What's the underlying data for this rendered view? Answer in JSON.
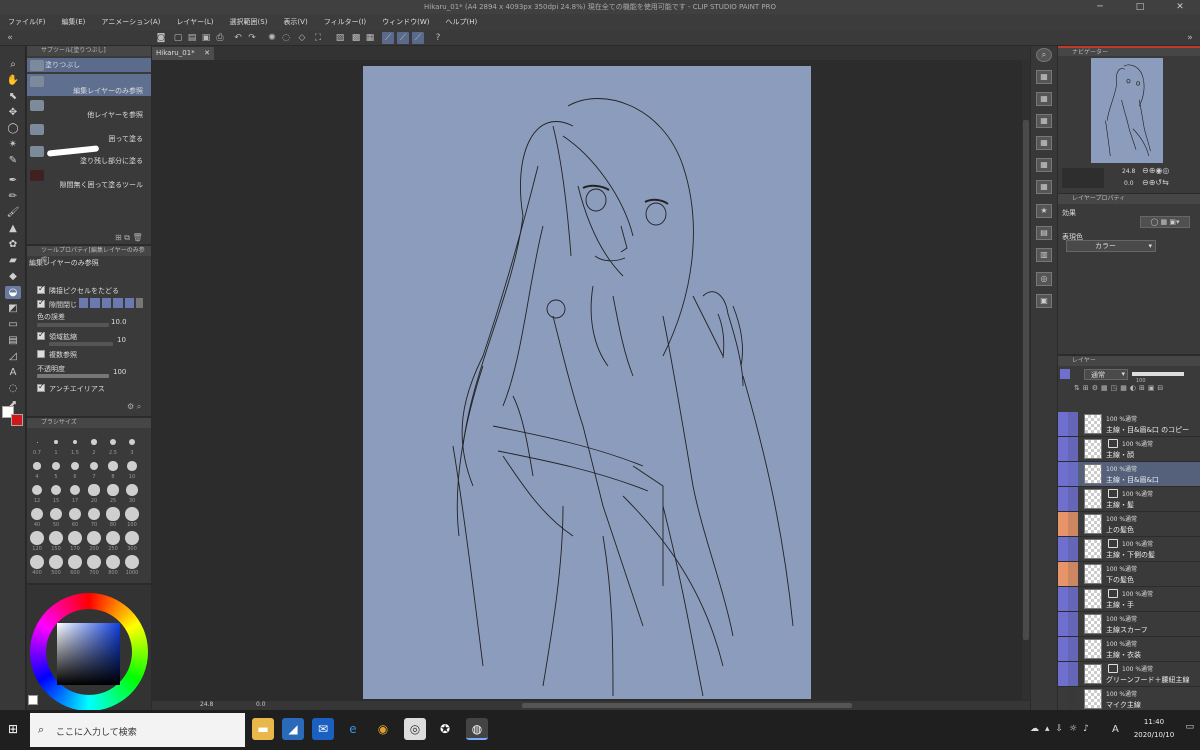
{
  "window": {
    "title": "Hikaru_01* (A4 2894 x 4093px 350dpi 24.8%)  現在全ての機能を使用可能です - CLIP STUDIO PAINT PRO"
  },
  "menu": [
    "ファイル(F)",
    "編集(E)",
    "アニメーション(A)",
    "レイヤー(L)",
    "選択範囲(S)",
    "表示(V)",
    "フィルター(I)",
    "ウィンドウ(W)",
    "ヘルプ(H)"
  ],
  "subtool": {
    "title": "サブツール[塗りつぶし]",
    "items": [
      {
        "label": "塗りつぶし"
      },
      {
        "label": "編集レイヤーのみ参照"
      },
      {
        "label": "他レイヤーを参照"
      },
      {
        "label": "囲って塗る"
      },
      {
        "label": "塗り残し部分に塗る"
      },
      {
        "label": "隙間無く囲って塗るツール"
      }
    ]
  },
  "toolprop": {
    "title": "ツールプロパティ[編集レイヤーのみ参照]",
    "name": "編集レイヤーのみ参照",
    "follow": "隣接ピクセルをたどる",
    "gap": "隙間閉じ",
    "tolerance_label": "色の誤差",
    "tolerance": "10.0",
    "expand_label": "領域拡縮",
    "expand": "10",
    "multi": "複数参照",
    "opacity_label": "不透明度",
    "opacity": "100",
    "aa": "アンチエイリアス"
  },
  "brushsize": {
    "title": "ブラシサイズ",
    "sizes": [
      "0.7",
      "1",
      "1.5",
      "2",
      "2.5",
      "3",
      "4",
      "5",
      "6",
      "7",
      "8",
      "10",
      "12",
      "15",
      "17",
      "20",
      "25",
      "30",
      "40",
      "50",
      "60",
      "70",
      "80",
      "100",
      "120",
      "150",
      "170",
      "200",
      "250",
      "300",
      "400",
      "500",
      "600",
      "700",
      "800",
      "1000"
    ]
  },
  "color": {
    "r": "222",
    "g": "3",
    "b": "95"
  },
  "canvas": {
    "tab": "Hikaru_01*",
    "zoom": "24.8",
    "angle": "0.0"
  },
  "navigator": {
    "title": "ナビゲーター",
    "zoom": "24.8",
    "angle": "0.0"
  },
  "layerprop": {
    "title": "レイヤープロパティ",
    "effect": "効果",
    "expression": "表現色",
    "color_mode": "カラー"
  },
  "layers": {
    "title": "レイヤー",
    "blend": "通常",
    "opacity": "100",
    "items": [
      {
        "top": "100 %通常",
        "name": "主線・目&眉&口 のコピー",
        "color": "#6f6fd0",
        "folder": false
      },
      {
        "top": "100 %通常",
        "name": "主線・顔",
        "color": "#6f6fd0",
        "folder": true
      },
      {
        "top": "100 %通常",
        "name": "主線・目&眉&口",
        "color": "#6f6fd0",
        "folder": false,
        "selected": true
      },
      {
        "top": "100 %通常",
        "name": "主線・髪",
        "color": "#6f6fd0",
        "folder": true
      },
      {
        "top": "100 %通常",
        "name": "上の髪色",
        "color": "#e8946a",
        "folder": false
      },
      {
        "top": "100 %通常",
        "name": "主線・下側の髪",
        "color": "#6f6fd0",
        "folder": true
      },
      {
        "top": "100 %通常",
        "name": "下の髪色",
        "color": "#e8946a",
        "folder": false
      },
      {
        "top": "100 %通常",
        "name": "主線・手",
        "color": "#6f6fd0",
        "folder": true
      },
      {
        "top": "100 %通常",
        "name": "主線スカーフ",
        "color": "#6f6fd0",
        "folder": false
      },
      {
        "top": "100 %通常",
        "name": "主線・衣装",
        "color": "#6f6fd0",
        "folder": false
      },
      {
        "top": "100 %通常",
        "name": "グリーンフード＋腰紐主線",
        "color": "#6f6fd0",
        "folder": true
      },
      {
        "top": "100 %通常",
        "name": "マイク主線",
        "color": "#3a3a3a",
        "folder": false
      }
    ]
  },
  "taskbar": {
    "search": "ここに入力して検索",
    "time": "11:40",
    "date": "2020/10/10",
    "ime": "A"
  }
}
